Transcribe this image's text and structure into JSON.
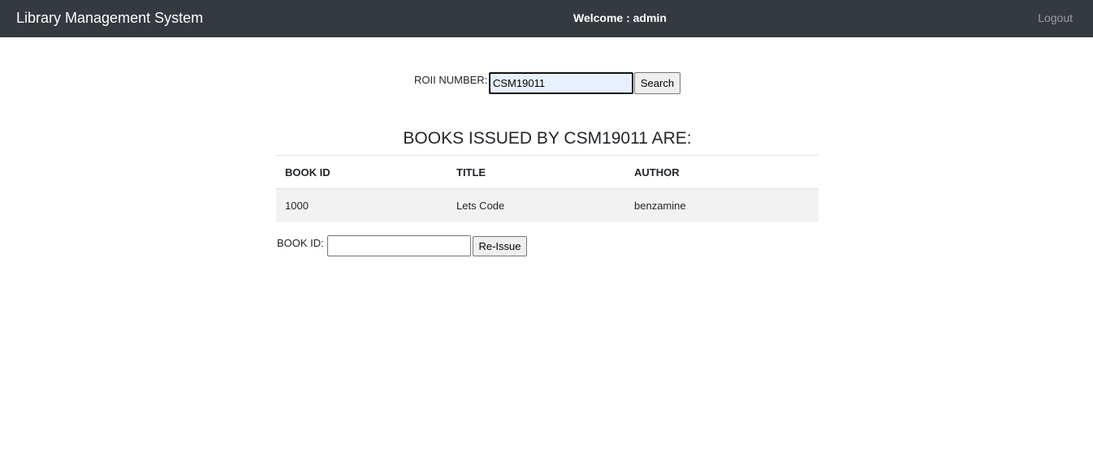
{
  "navbar": {
    "brand": "Library Management System",
    "welcome": "Welcome : admin",
    "logout": "Logout"
  },
  "search": {
    "label": "ROII NUMBER:",
    "value": "CSM19011",
    "button_label": "Search"
  },
  "heading": "BOOKS ISSUED BY CSM19011 ARE:",
  "table": {
    "headers": [
      "BOOK ID",
      "TITLE",
      "AUTHOR"
    ],
    "rows": [
      [
        "1000",
        "Lets Code",
        "benzamine"
      ]
    ]
  },
  "reissue": {
    "label": "BOOK ID:",
    "value": "",
    "button_label": "Re-Issue"
  },
  "colors": {
    "navbar_bg": "#343a40",
    "row_bg": "#f2f2f2",
    "input_autofill_bg": "#e8f0fe"
  }
}
